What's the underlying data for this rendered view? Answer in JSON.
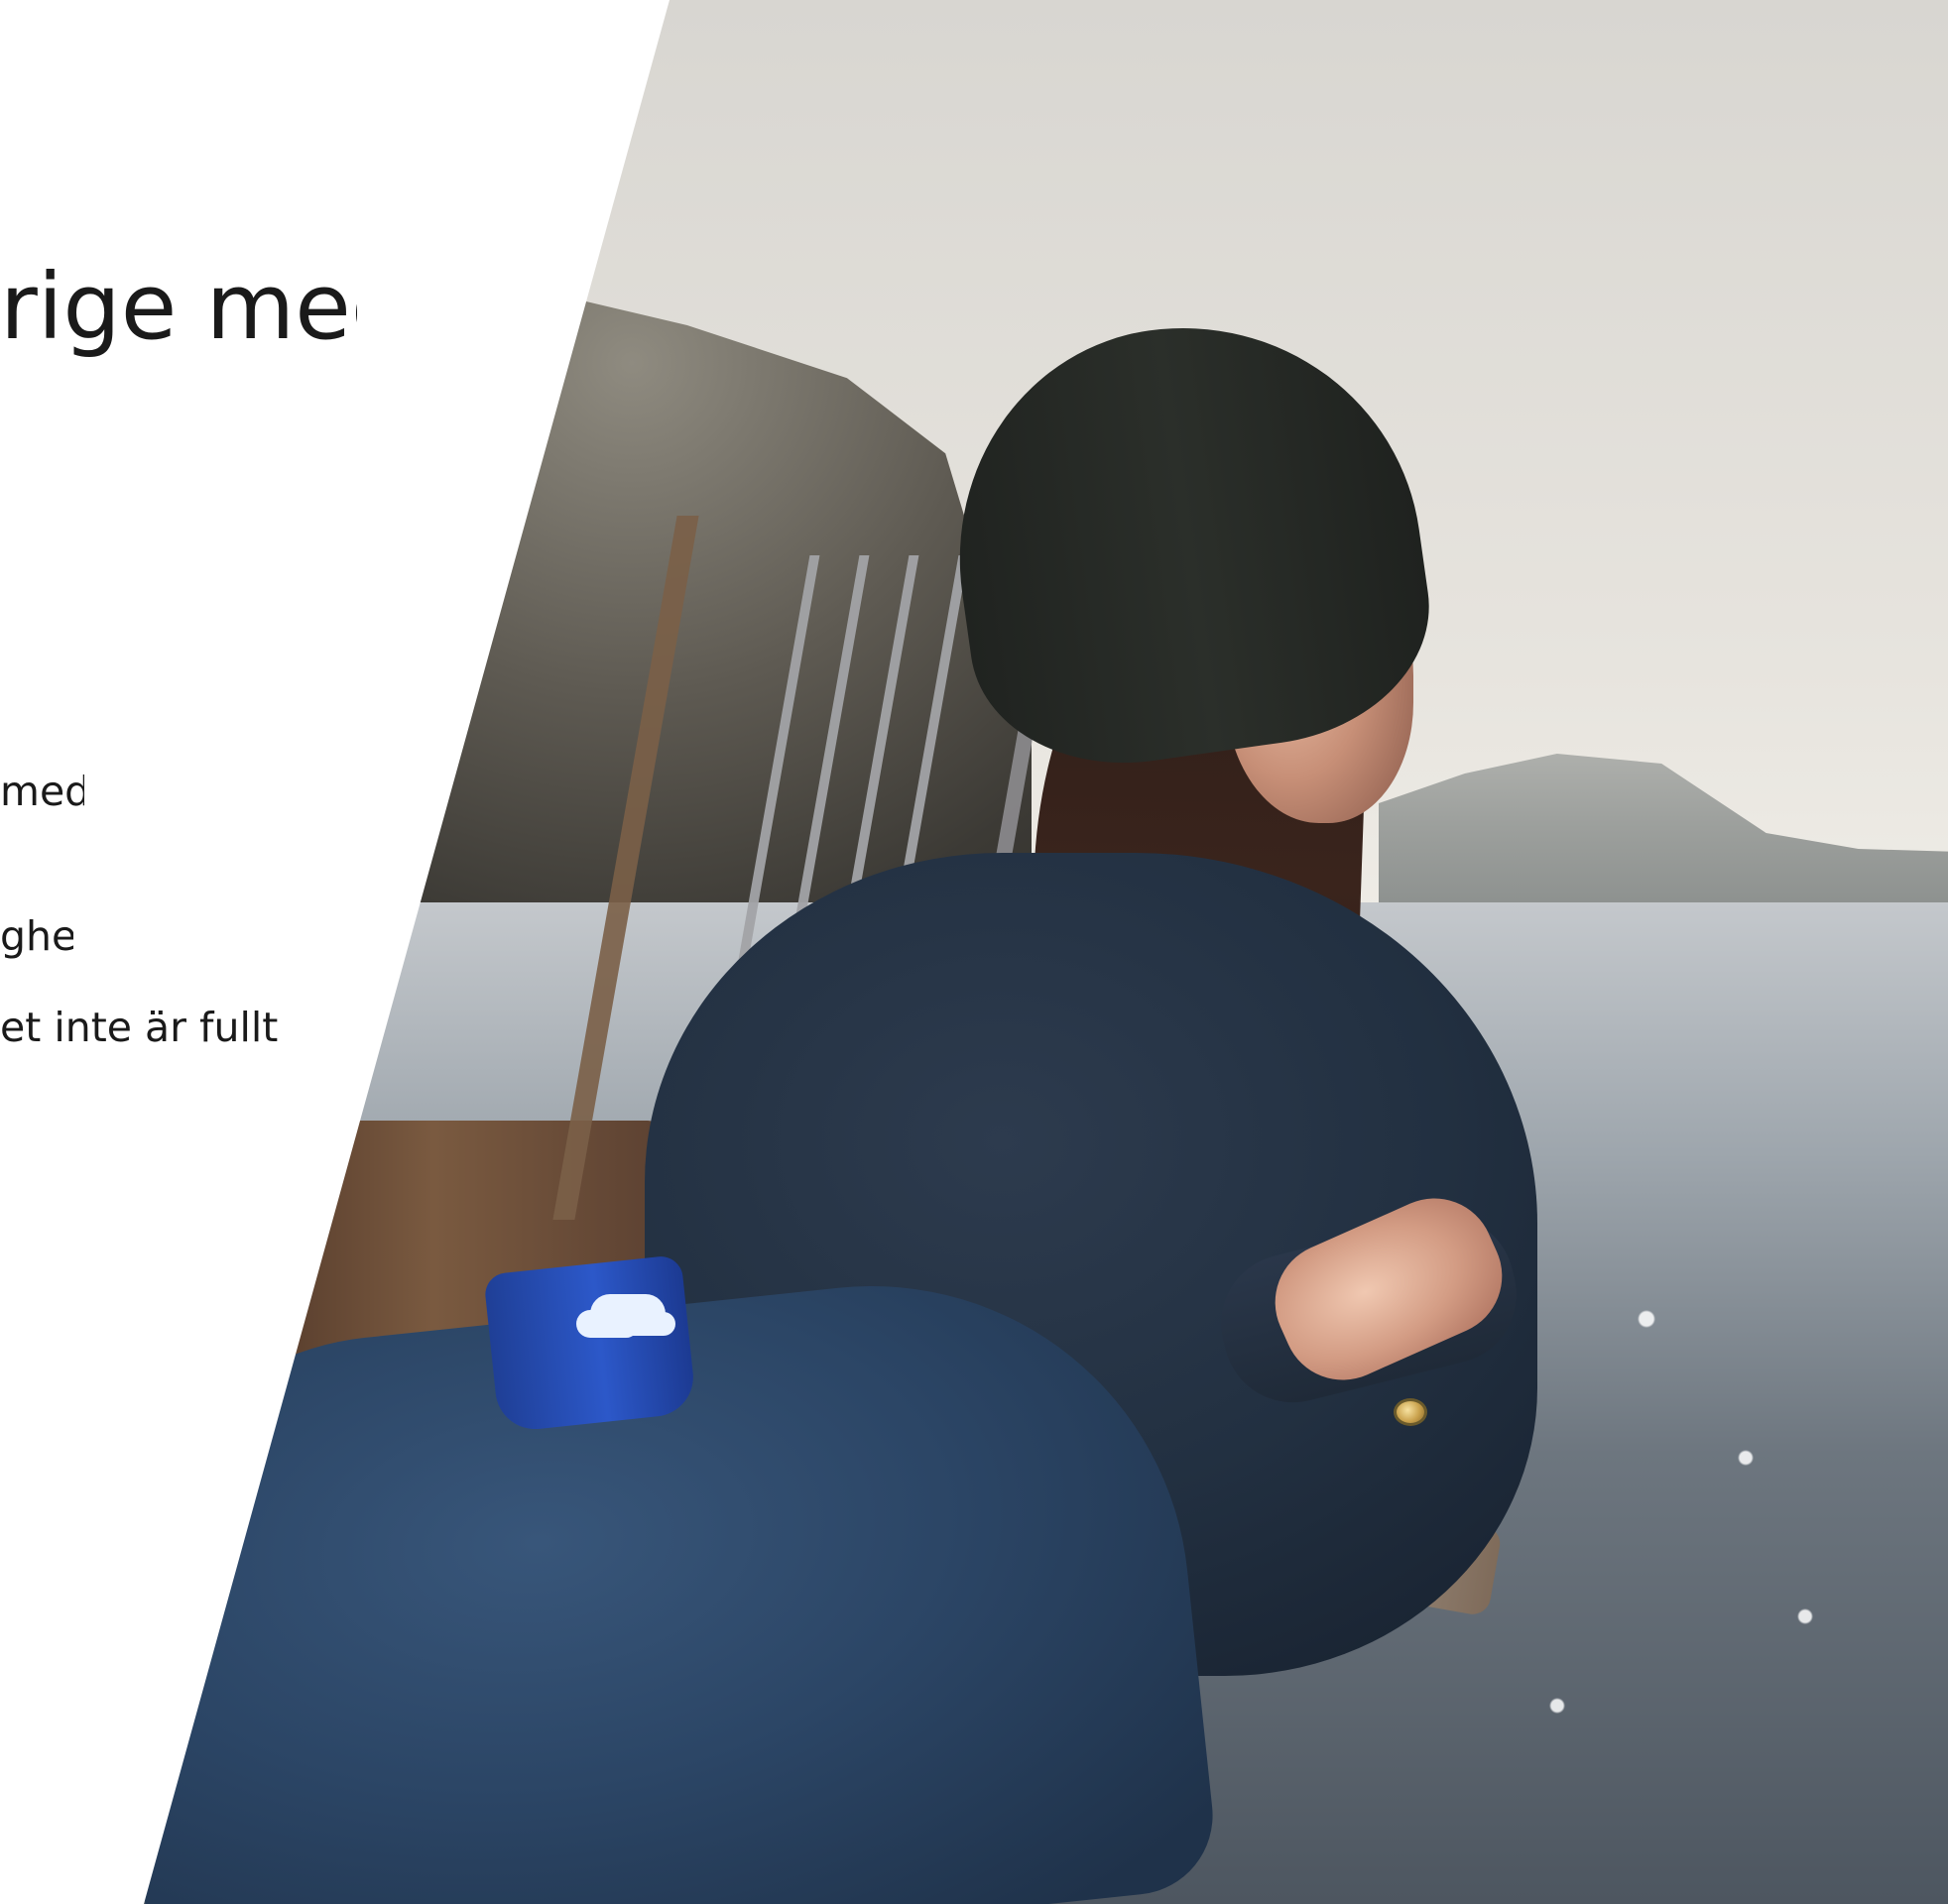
{
  "hero": {
    "heading_visible": "rige med",
    "text_lines_visible": [
      "med",
      "ghet",
      "et inte är fullt"
    ]
  }
}
